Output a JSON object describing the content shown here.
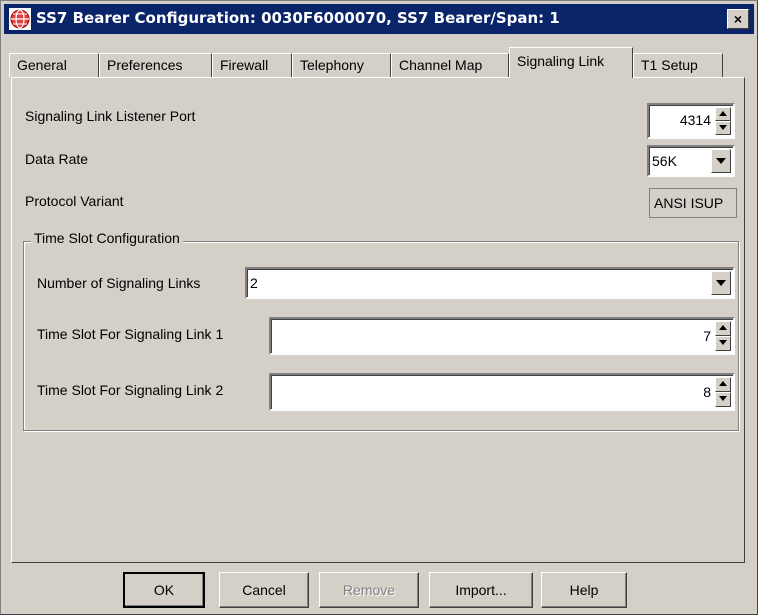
{
  "window": {
    "title": "SS7 Bearer Configuration: 0030F6000070, SS7 Bearer/Span: 1",
    "close_label": "×",
    "app_icon": "globe-icon"
  },
  "tabs": [
    {
      "label": "General",
      "active": false
    },
    {
      "label": "Preferences",
      "active": false
    },
    {
      "label": "Firewall",
      "active": false
    },
    {
      "label": "Telephony",
      "active": false
    },
    {
      "label": "Channel Map",
      "active": false
    },
    {
      "label": "Signaling Link",
      "active": true
    },
    {
      "label": "T1 Setup",
      "active": false
    }
  ],
  "signaling_link": {
    "listener_port_label": "Signaling Link Listener Port",
    "listener_port_value": "4314",
    "data_rate_label": "Data Rate",
    "data_rate_value": "56K",
    "protocol_variant_label": "Protocol Variant",
    "protocol_variant_value": "ANSI ISUP",
    "time_slot_group": {
      "title": "Time Slot Configuration",
      "num_links_label": "Number of Signaling Links",
      "num_links_value": "2",
      "slot1_label": "Time Slot For Signaling Link 1",
      "slot1_value": "7",
      "slot2_label": "Time Slot For Signaling Link 2",
      "slot2_value": "8"
    }
  },
  "buttons": {
    "ok": "OK",
    "cancel": "Cancel",
    "remove": "Remove",
    "import": "Import...",
    "help": "Help"
  }
}
